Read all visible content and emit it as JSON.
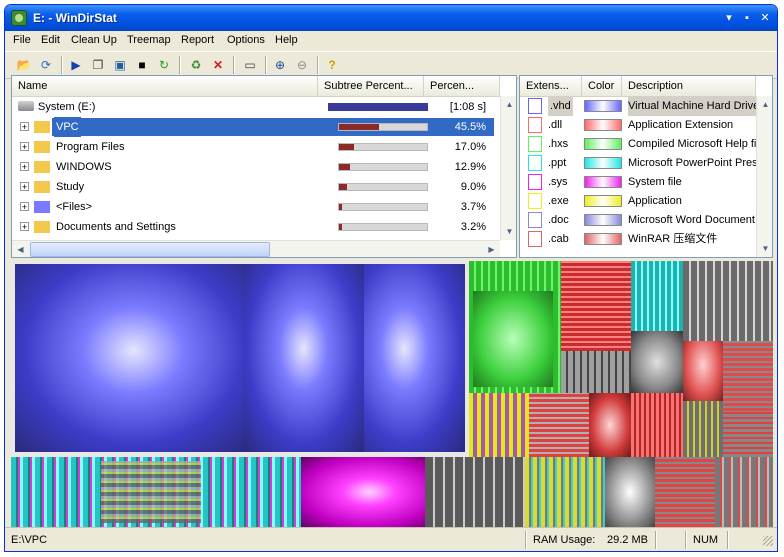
{
  "window": {
    "title": "E: - WinDirStat"
  },
  "menu": [
    "File",
    "Edit",
    "Clean Up",
    "Treemap",
    "Report",
    "Options",
    "Help"
  ],
  "toolbar": {
    "icons": [
      "open-icon",
      "refresh-all-icon",
      "play-icon",
      "copy-icon",
      "explorer-icon",
      "command-prompt-icon",
      "refresh-icon",
      "recycle-icon",
      "delete-icon",
      "new-folder-icon",
      "zoom-in-icon",
      "zoom-out-icon",
      "help-icon"
    ]
  },
  "tree": {
    "headers": {
      "name": "Name",
      "subtree": "Subtree Percent...",
      "percent": "Percen..."
    },
    "root": {
      "label": "System (E:)",
      "time": "[1:08 s]",
      "fraction": 1.0
    },
    "rows": [
      {
        "label": "VPC",
        "percent": "45.5%",
        "fraction": 0.455,
        "selected": true,
        "icon": "folder"
      },
      {
        "label": "Program Files",
        "percent": "17.0%",
        "fraction": 0.17,
        "selected": false,
        "icon": "folder"
      },
      {
        "label": "WINDOWS",
        "percent": "12.9%",
        "fraction": 0.129,
        "selected": false,
        "icon": "folder"
      },
      {
        "label": "Study",
        "percent": "9.0%",
        "fraction": 0.09,
        "selected": false,
        "icon": "folder"
      },
      {
        "label": "<Files>",
        "percent": "3.7%",
        "fraction": 0.037,
        "selected": false,
        "icon": "files"
      },
      {
        "label": "Documents and Settings",
        "percent": "3.2%",
        "fraction": 0.032,
        "selected": false,
        "icon": "folder"
      }
    ]
  },
  "extensions": {
    "headers": {
      "ext": "Extens...",
      "color": "Color",
      "desc": "Description"
    },
    "rows": [
      {
        "ext": ".vhd",
        "color": "#6666ff",
        "desc": "Virtual Machine Hard Drive",
        "selected": true,
        "icon": "drive-icon"
      },
      {
        "ext": ".dll",
        "color": "#ff6a6a",
        "desc": "Application Extension",
        "selected": false,
        "icon": "dll-icon"
      },
      {
        "ext": ".hxs",
        "color": "#5fef5f",
        "desc": "Compiled Microsoft Help fil",
        "selected": false,
        "icon": "help-file-icon"
      },
      {
        "ext": ".ppt",
        "color": "#22e5e5",
        "desc": "Microsoft PowerPoint Pres",
        "selected": false,
        "icon": "ppt-icon"
      },
      {
        "ext": ".sys",
        "color": "#ee22ee",
        "desc": "System file",
        "selected": false,
        "icon": "sys-icon"
      },
      {
        "ext": ".exe",
        "color": "#eeee22",
        "desc": "Application",
        "selected": false,
        "icon": "exe-icon"
      },
      {
        "ext": ".doc",
        "color": "#8888dd",
        "desc": "Microsoft Word Document",
        "selected": false,
        "icon": "doc-icon"
      },
      {
        "ext": ".cab",
        "color": "#dd6666",
        "desc": "WinRAR 压缩文件",
        "selected": false,
        "icon": "cab-icon"
      }
    ]
  },
  "status": {
    "path": "E:\\VPC",
    "ram_label": "RAM Usage:",
    "ram_value": "29.2 MB",
    "num": "NUM"
  }
}
